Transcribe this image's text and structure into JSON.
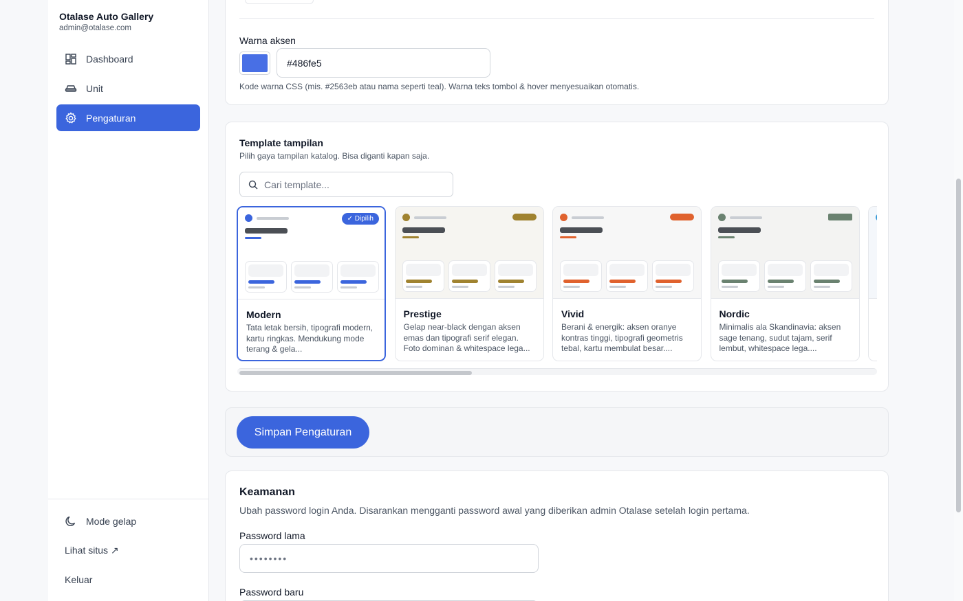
{
  "sidebar": {
    "brand_name": "Otalase Auto Gallery",
    "brand_email": "admin@otalase.com",
    "items": [
      {
        "label": "Dashboard",
        "icon": "dashboard-icon"
      },
      {
        "label": "Unit",
        "icon": "car-icon"
      },
      {
        "label": "Pengaturan",
        "icon": "gear-icon",
        "active": true
      }
    ],
    "dark_mode_label": "Mode gelap",
    "view_site_label": "Lihat situs ↗",
    "logout_label": "Keluar"
  },
  "accent": {
    "label": "Warna aksen",
    "value": "#486fe5",
    "hint": "Kode warna CSS (mis. #2563eb atau nama seperti teal). Warna teks tombol & hover menyesuaikan otomatis."
  },
  "template": {
    "title": "Template tampilan",
    "subtitle": "Pilih gaya tampilan katalog. Bisa diganti kapan saja.",
    "search_placeholder": "Cari template...",
    "selected_badge": "✓ Dipilih",
    "items": [
      {
        "name": "Modern",
        "desc": "Tata letak bersih, tipografi modern, kartu ringkas. Mendukung mode terang & gela...",
        "accent": "#3b65dd",
        "bg": "#ffffff",
        "selected": true
      },
      {
        "name": "Prestige",
        "desc": "Gelap near-black dengan aksen emas dan tipografi serif elegan. Foto dominan & whitespace lega...",
        "accent": "#a08330",
        "bg": "#f6f5f1"
      },
      {
        "name": "Vivid",
        "desc": "Berani & energik: aksen oranye kontras tinggi, tipografi geometris tebal, kartu membulat besar....",
        "accent": "#e0622e",
        "bg": "#f7f7f7"
      },
      {
        "name": "Nordic",
        "desc": "Minimalis ala Skandinavia: aksen sage tenang, sudut tajam, serif lembut, whitespace lega....",
        "accent": "#6a8270",
        "bg": "#f3f3f2"
      }
    ]
  },
  "save_button_label": "Simpan Pengaturan",
  "security": {
    "title": "Keamanan",
    "desc": "Ubah password login Anda. Disarankan mengganti password awal yang diberikan admin Otalase setelah login pertama.",
    "old_password_label": "Password lama",
    "old_password_value": "••••••••",
    "new_password_label": "Password baru"
  }
}
